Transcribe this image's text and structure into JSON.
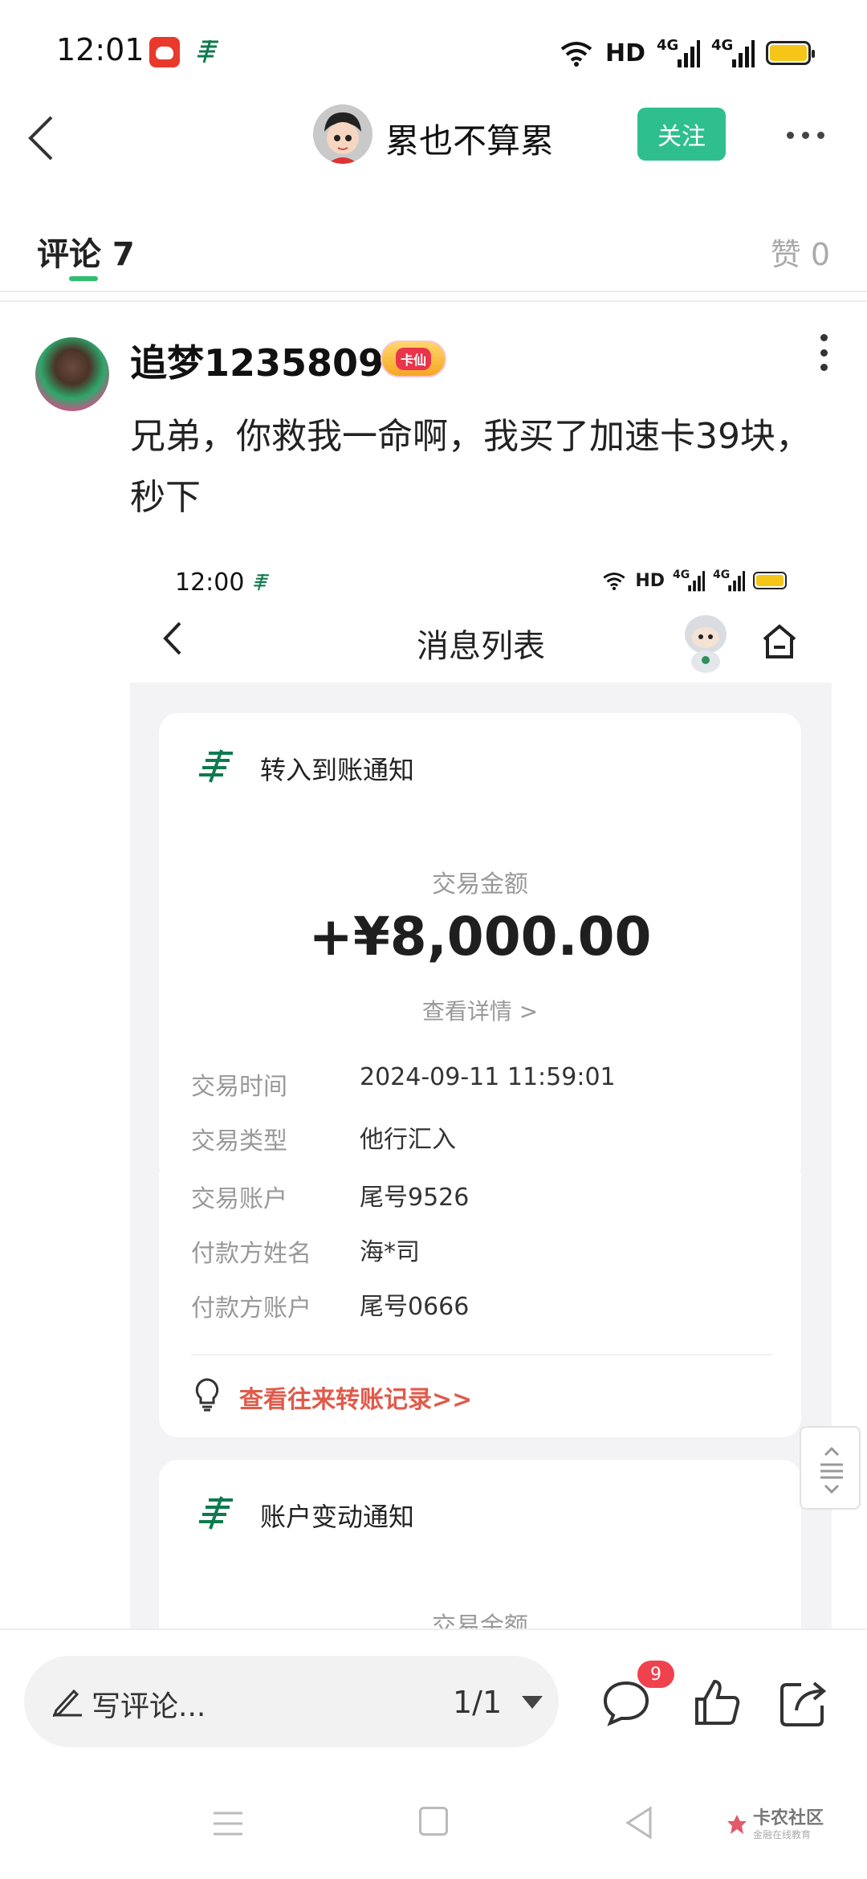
{
  "status_bar": {
    "time": "12:01",
    "network_hd": "HD",
    "signal_1": "4G",
    "signal_2": "4G"
  },
  "header": {
    "username": "累也不算累",
    "follow_label": "关注"
  },
  "tabs": {
    "comment_label": "评论 7",
    "like_label": "赞 0"
  },
  "comment": {
    "username": "追梦1235809",
    "badge_label": "卡仙",
    "text": "兄弟，你救我一命啊，我买了加速卡39块，秒下"
  },
  "embedded_screenshot": {
    "time": "12:00",
    "network_hd": "HD",
    "signal_1": "4G",
    "signal_2": "4G",
    "title": "消息列表",
    "card1": {
      "title": "转入到账通知",
      "amount_label": "交易金额",
      "amount": "+¥8,000.00",
      "detail_link": "查看详情 >",
      "rows": [
        {
          "label": "交易时间",
          "value": "2024-09-11 11:59:01"
        },
        {
          "label": "交易类型",
          "value": "他行汇入"
        },
        {
          "label": "交易账户",
          "value": "尾号9526"
        },
        {
          "label": "付款方姓名",
          "value": "海*司"
        },
        {
          "label": "付款方账户",
          "value": "尾号0666"
        }
      ],
      "record_link": "查看往来转账记录>>"
    },
    "card2": {
      "title": "账户变动通知",
      "amount_label": "交易金额"
    }
  },
  "bottom_bar": {
    "comment_placeholder": "写评论...",
    "page_indicator": "1/1",
    "comment_badge": "9"
  },
  "watermark": {
    "title": "卡农社区",
    "subtitle": "金融在线教育"
  },
  "colors": {
    "accent_green": "#2fbf8f",
    "tab_underline": "#2fbf6f",
    "link_red": "#e05a4a",
    "badge_red": "#f0424d",
    "bank_green": "#0f7a4f"
  }
}
